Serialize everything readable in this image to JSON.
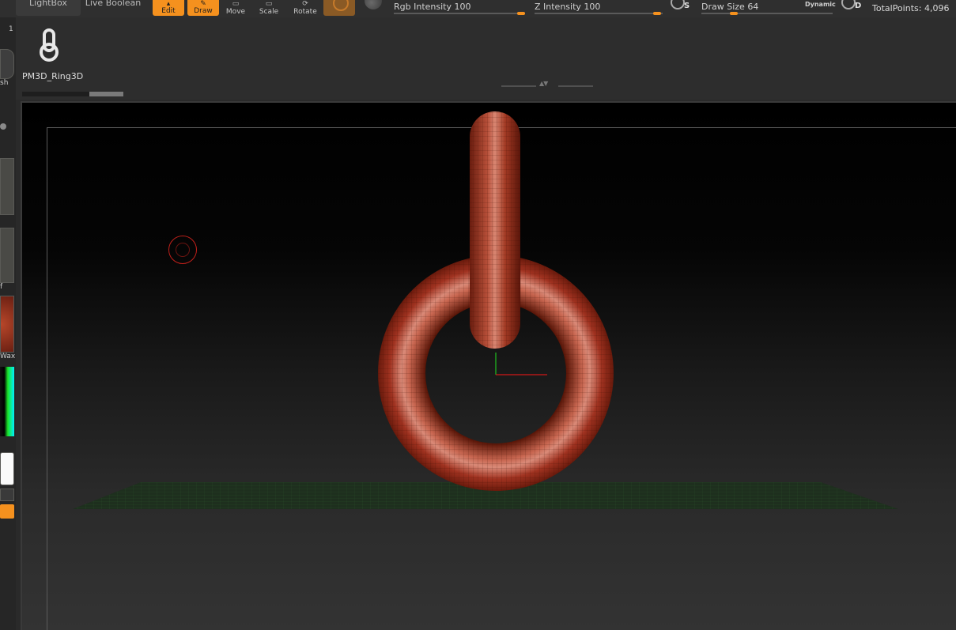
{
  "toolbar": {
    "lightbox_label": "LightBox",
    "liveboolean_label": "Live Boolean",
    "edit_label": "Edit",
    "draw_label": "Draw",
    "move_label": "Move",
    "scale_label": "Scale",
    "rotate_label": "Rotate",
    "rgb_intensity": {
      "label": "Rgb Intensity",
      "value": "100"
    },
    "z_intensity": {
      "label": "Z Intensity",
      "value": "100"
    },
    "draw_size": {
      "label": "Draw Size",
      "value": "64"
    },
    "dynamic_label": "Dynamic",
    "s_letter": "S",
    "d_letter": "D",
    "total_points_label": "TotalPoints:",
    "total_points_value": "4,096"
  },
  "left_panel": {
    "label_top": "sh",
    "label_mid": "f",
    "label_material": "Wax"
  },
  "shelf": {
    "number": "1",
    "tool_name": "PM3D_Ring3D"
  },
  "colors": {
    "accent": "#f5911e",
    "mesh_red": "#a8361f",
    "floor_grid": "#1f3a1f"
  }
}
